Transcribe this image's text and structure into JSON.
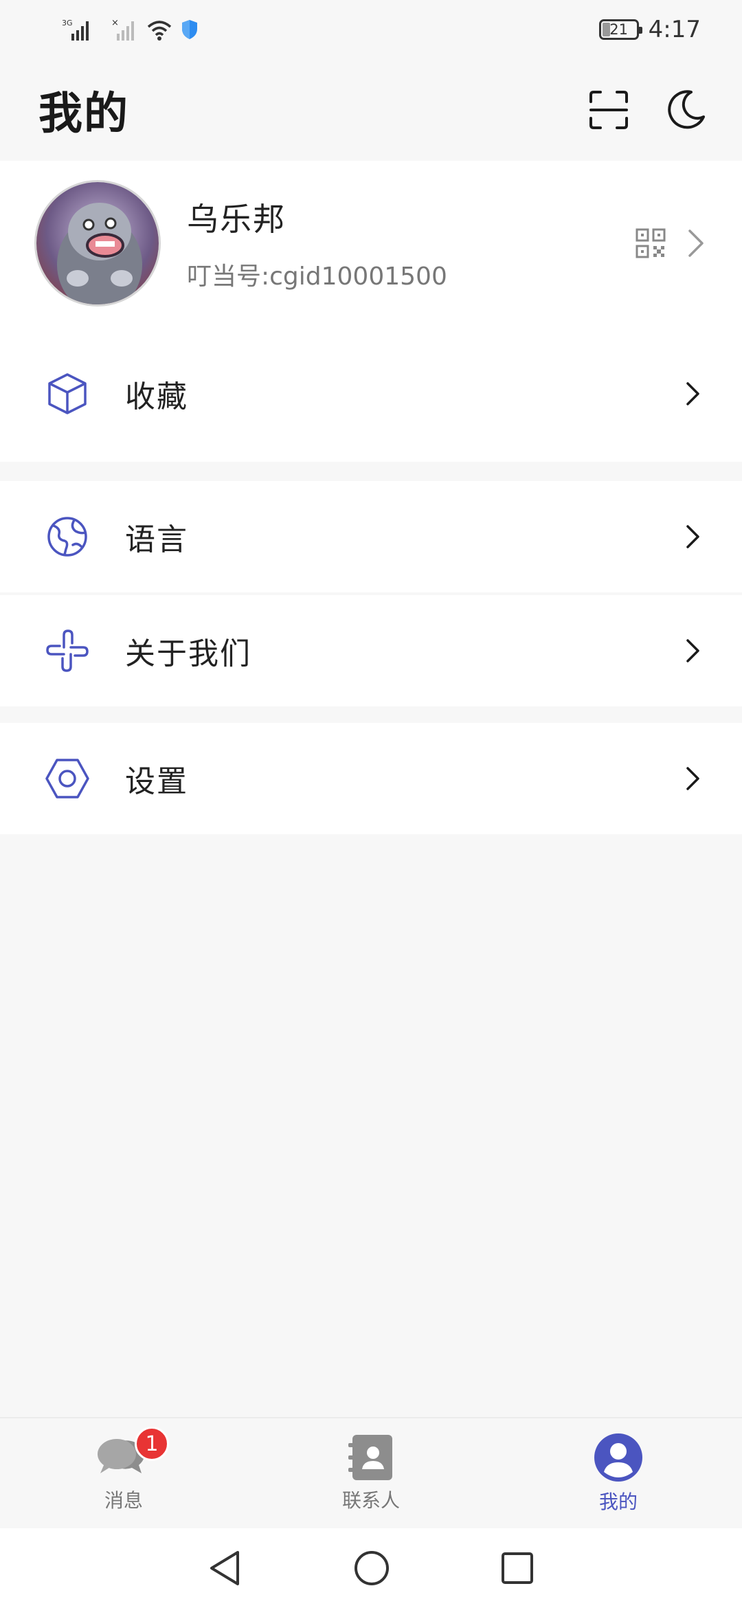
{
  "status_bar": {
    "network_label": "3G",
    "battery_level": "21",
    "time": "4:17"
  },
  "header": {
    "title": "我的",
    "scan_icon": "scan-icon",
    "dark_mode_icon": "moon-icon"
  },
  "profile": {
    "name": "乌乐邦",
    "id_text": "叮当号:cgid10001500",
    "qr_icon": "qr-code-icon"
  },
  "menu": [
    {
      "label": "收藏",
      "icon": "cube-icon"
    },
    {
      "label": "语言",
      "icon": "globe-icon"
    },
    {
      "label": "关于我们",
      "icon": "link-cross-icon"
    },
    {
      "label": "设置",
      "icon": "hexagon-settings-icon"
    }
  ],
  "tabbar": {
    "tabs": [
      {
        "label": "消息",
        "icon": "chat-bubbles-icon",
        "badge": "1",
        "active": false
      },
      {
        "label": "联系人",
        "icon": "contacts-book-icon",
        "active": false
      },
      {
        "label": "我的",
        "icon": "user-profile-icon",
        "active": true
      }
    ]
  },
  "colors": {
    "accent": "#4b55c0",
    "icon_outline": "#4b55c0",
    "badge": "#e83434",
    "background": "#f7f7f7"
  }
}
